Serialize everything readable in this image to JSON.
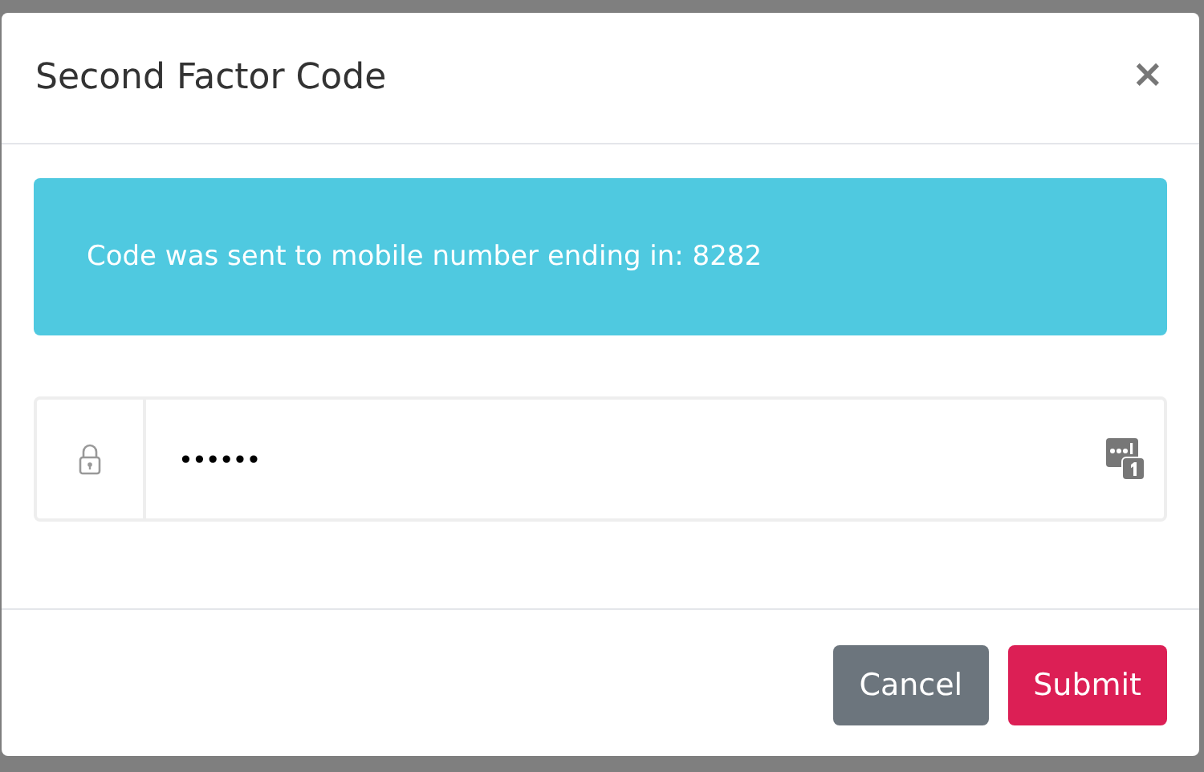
{
  "dialog": {
    "title": "Second Factor Code",
    "close": "×"
  },
  "alert": {
    "message": "Code was sent to mobile number ending in: 8282"
  },
  "code_field": {
    "value": "••••••"
  },
  "buttons": [
    {
      "label": "Cancel",
      "kind": "secondary"
    },
    {
      "label": "Submit",
      "kind": "primary"
    }
  ]
}
